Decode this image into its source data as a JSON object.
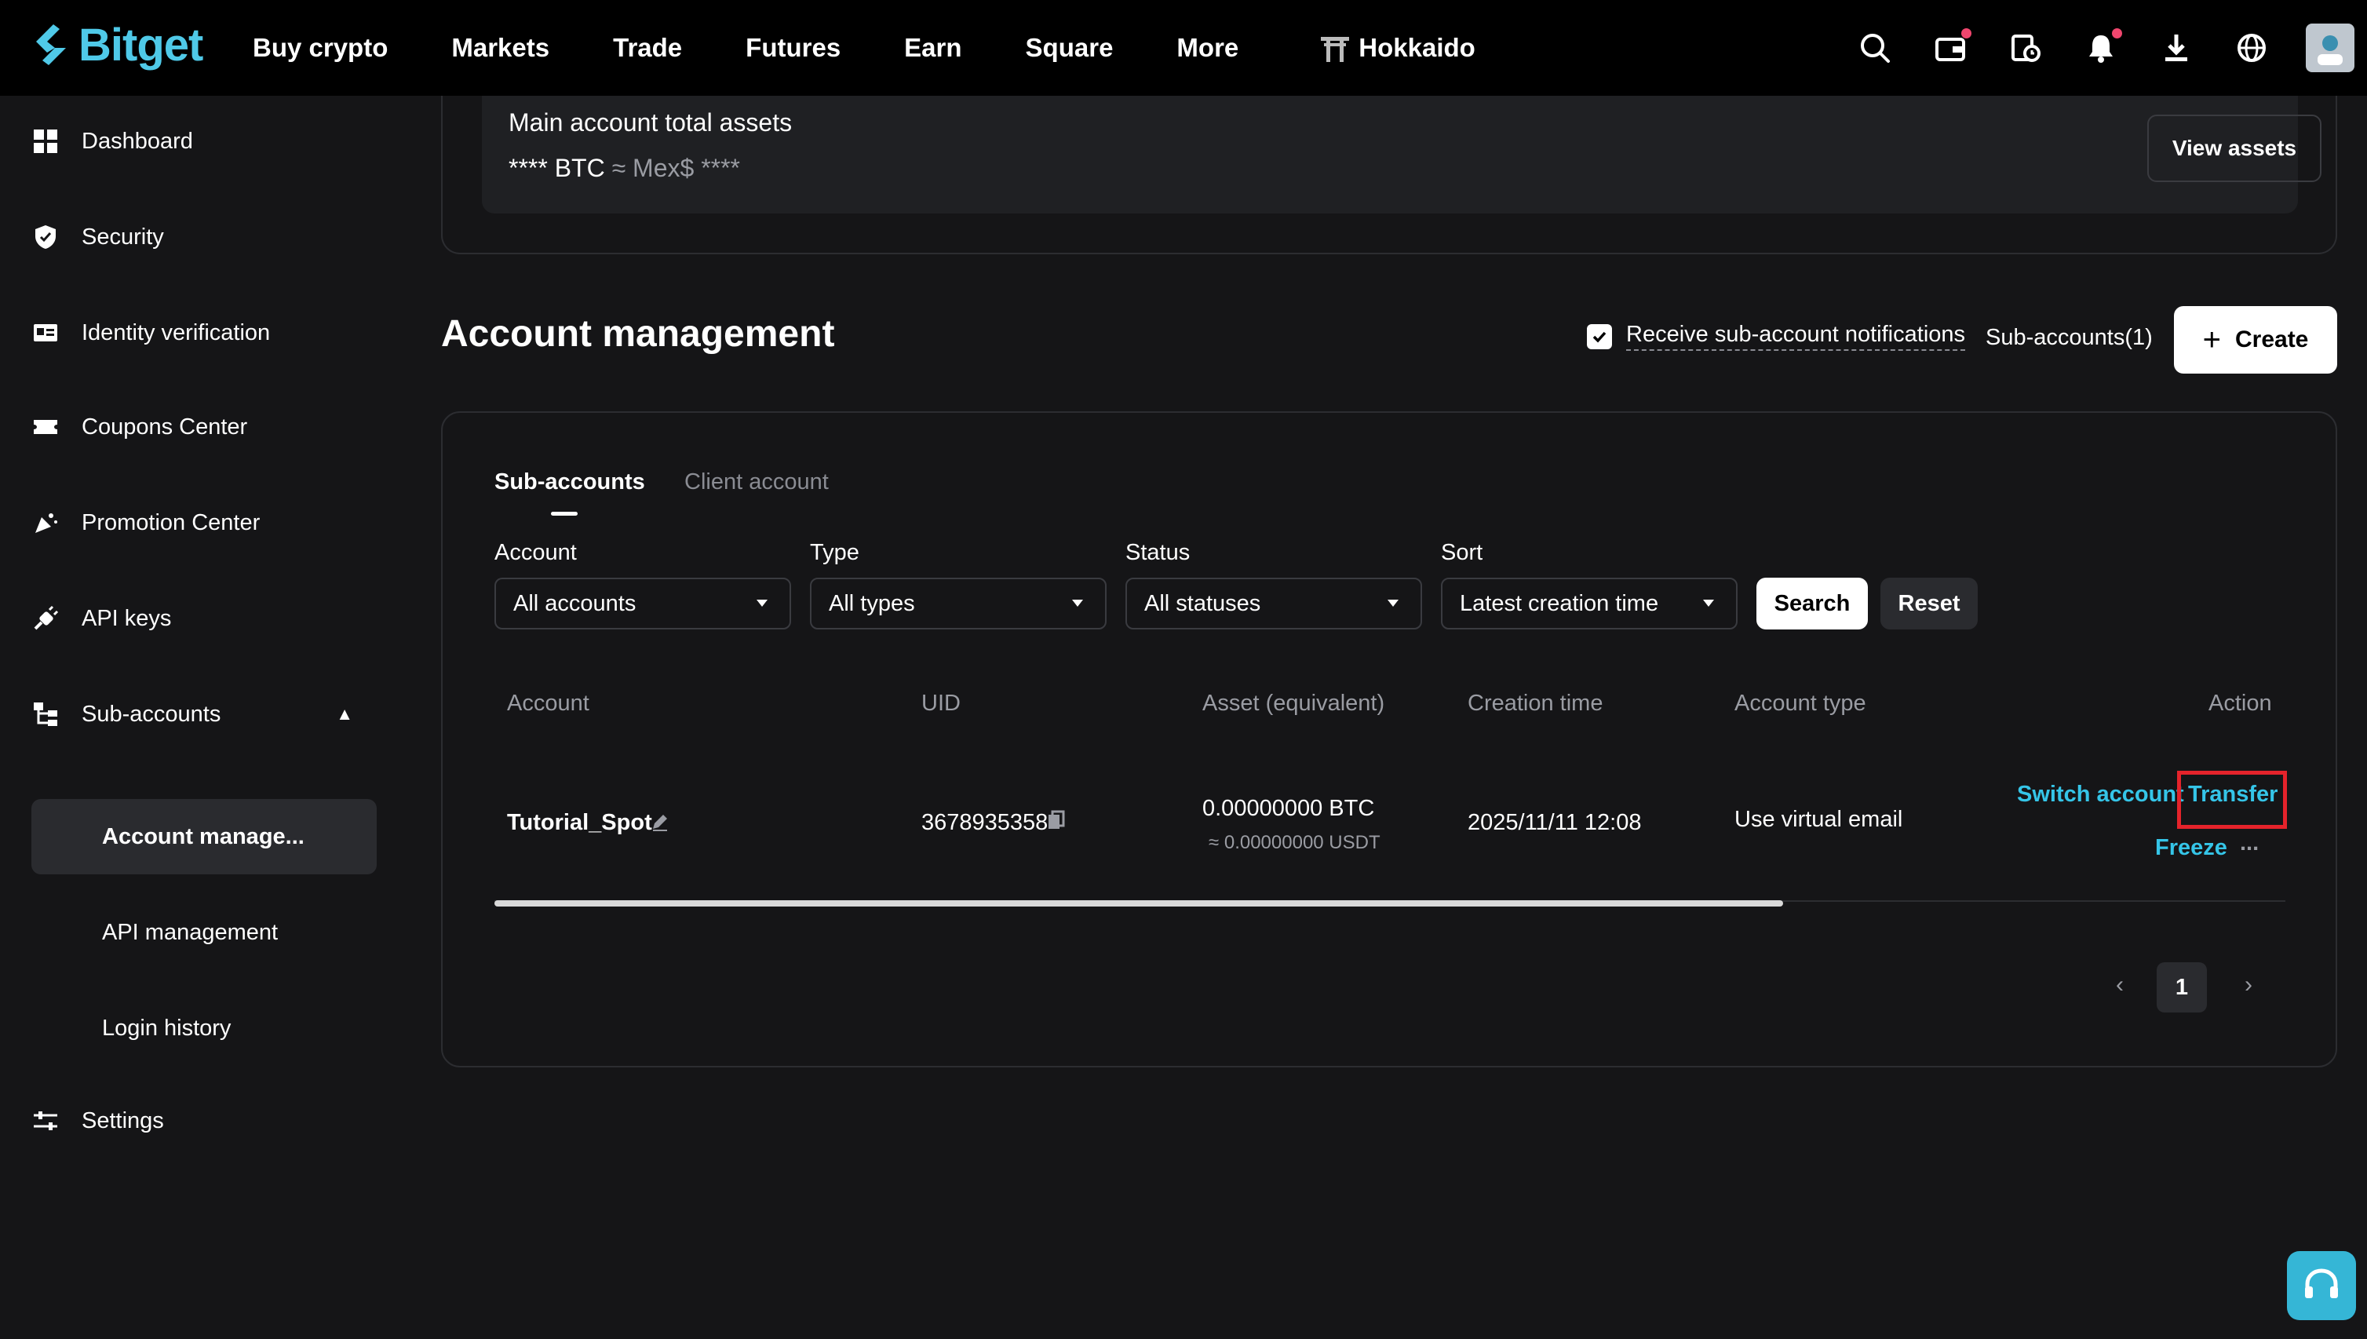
{
  "topnav": {
    "logo_text": "Bitget",
    "links": [
      "Buy crypto",
      "Markets",
      "Trade",
      "Futures",
      "Earn",
      "Square",
      "More"
    ],
    "promo_link": "Hokkaido",
    "icons": [
      "search-icon",
      "wallet-icon",
      "history-icon",
      "bell-icon",
      "download-icon",
      "globe-icon",
      "avatar"
    ]
  },
  "sidebar": {
    "items": [
      {
        "label": "Dashboard",
        "icon": "grid-icon"
      },
      {
        "label": "Security",
        "icon": "shield-icon"
      },
      {
        "label": "Identity verification",
        "icon": "id-card-icon"
      },
      {
        "label": "Coupons Center",
        "icon": "ticket-icon"
      },
      {
        "label": "Promotion Center",
        "icon": "megaphone-icon"
      },
      {
        "label": "API keys",
        "icon": "plug-icon"
      },
      {
        "label": "Sub-accounts",
        "icon": "hierarchy-icon"
      },
      {
        "label": "Settings",
        "icon": "sliders-icon"
      }
    ],
    "sub_items": [
      "Account manage...",
      "API management",
      "Login history"
    ]
  },
  "assets": {
    "title": "Main account total assets",
    "value_btc": "**** BTC",
    "value_fiat": "≈ Mex$ ****",
    "view_button": "View assets"
  },
  "account_management": {
    "title": "Account management",
    "notify_label": "Receive sub-account notifications",
    "notify_checked": true,
    "subaccount_count": "Sub-accounts(1)",
    "create_button": "Create"
  },
  "tabs": [
    {
      "label": "Sub-accounts",
      "active": true
    },
    {
      "label": "Client account",
      "active": false
    }
  ],
  "filters": {
    "account": {
      "label": "Account",
      "value": "All accounts"
    },
    "type": {
      "label": "Type",
      "value": "All types"
    },
    "status": {
      "label": "Status",
      "value": "All statuses"
    },
    "sort": {
      "label": "Sort",
      "value": "Latest creation time"
    },
    "search_button": "Search",
    "reset_button": "Reset"
  },
  "table": {
    "columns": [
      "Account",
      "UID",
      "Asset (equivalent)",
      "Creation time",
      "Account type",
      "Action"
    ],
    "rows": [
      {
        "account": "Tutorial_Spot",
        "uid": "3678935358",
        "asset_btc": "0.00000000 BTC",
        "asset_usdt": "≈  0.00000000 USDT",
        "creation_time": "2025/11/11 12:08",
        "account_type": "Use virtual email",
        "actions": [
          "Switch account",
          "Transfer",
          "Freeze",
          "..."
        ]
      }
    ]
  },
  "pagination": {
    "current_page": "1",
    "prev": "‹",
    "next": "›"
  },
  "colors": {
    "accent": "#35c5e8",
    "highlight": "#e5232b",
    "background": "#151517"
  }
}
